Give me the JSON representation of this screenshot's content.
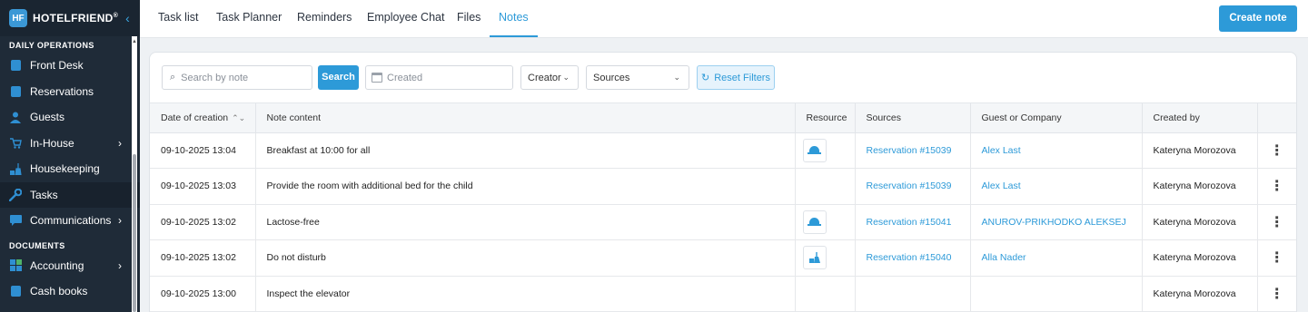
{
  "brand": {
    "name": "HOTELFRIEND",
    "mark": "HF",
    "registered": "®"
  },
  "sidebar": {
    "sections": [
      {
        "label": "DAILY OPERATIONS"
      },
      {
        "label": "DOCUMENTS"
      }
    ],
    "items": [
      {
        "label": "Front Desk",
        "icon": "front-desk-icon",
        "has_children": false
      },
      {
        "label": "Reservations",
        "icon": "reservations-icon",
        "has_children": false
      },
      {
        "label": "Guests",
        "icon": "guests-icon",
        "has_children": false
      },
      {
        "label": "In-House",
        "icon": "in-house-icon",
        "has_children": true
      },
      {
        "label": "Housekeeping",
        "icon": "housekeeping-icon",
        "has_children": false
      },
      {
        "label": "Tasks",
        "icon": "wrench-icon",
        "has_children": false,
        "active": true
      },
      {
        "label": "Communications",
        "icon": "chat-icon",
        "has_children": true
      },
      {
        "label": "Accounting",
        "icon": "accounting-icon",
        "has_children": true
      },
      {
        "label": "Cash books",
        "icon": "book-icon",
        "has_children": false
      }
    ]
  },
  "tabs": [
    {
      "label": "Task list"
    },
    {
      "label": "Task Planner"
    },
    {
      "label": "Reminders"
    },
    {
      "label": "Employee Chat"
    },
    {
      "label": "Files"
    },
    {
      "label": "Notes",
      "active": true
    }
  ],
  "create_button": "Create note",
  "filters": {
    "search_placeholder": "Search by note",
    "search_button": "Search",
    "date_placeholder": "Created",
    "creator_label": "Creator",
    "sources_label": "Sources",
    "reset_label": "Reset Filters"
  },
  "table": {
    "columns": [
      "Date of creation",
      "Note content",
      "Resource",
      "Sources",
      "Guest or Company",
      "Created by",
      ""
    ],
    "rows": [
      {
        "date": "09-10-2025 13:04",
        "note": "Breakfast at 10:00 for all",
        "resource": "cloche-icon",
        "source": "Reservation #15039",
        "guest": "Alex Last",
        "created_by": "Kateryna Morozova"
      },
      {
        "date": "09-10-2025 13:03",
        "note": "Provide the room with additional bed for the child",
        "resource": "",
        "source": "Reservation #15039",
        "guest": "Alex Last",
        "created_by": "Kateryna Morozova"
      },
      {
        "date": "09-10-2025 13:02",
        "note": "Lactose-free",
        "resource": "cloche-icon",
        "source": "Reservation #15041",
        "guest": "ANUROV-PRIKHODKO ALEKSEJ",
        "created_by": "Kateryna Morozova"
      },
      {
        "date": "09-10-2025 13:02",
        "note": "Do not disturb",
        "resource": "housekeeping-icon",
        "source": "Reservation #15040",
        "guest": "Alla Nader",
        "created_by": "Kateryna Morozova"
      },
      {
        "date": "09-10-2025 13:00",
        "note": "Inspect the elevator",
        "resource": "",
        "source": "",
        "guest": "",
        "created_by": "Kateryna Morozova"
      }
    ]
  },
  "colors": {
    "accent": "#2d9ad8",
    "sidebar_bg": "#1f2b38",
    "page_bg": "#eef1f4"
  }
}
